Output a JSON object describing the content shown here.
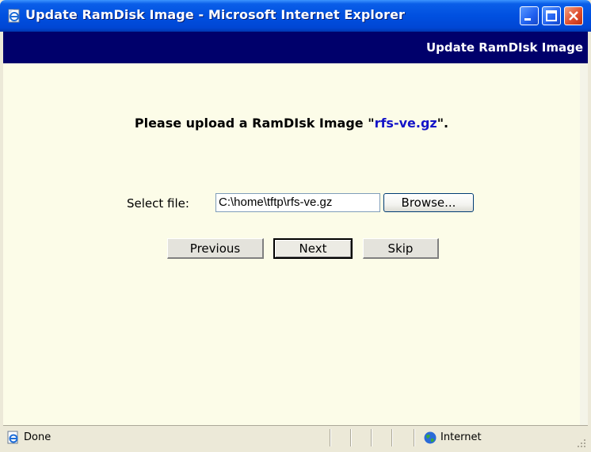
{
  "window": {
    "title": "Update RamDisk Image - Microsoft Internet Explorer",
    "controls": [
      "minimize-icon",
      "maximize-icon",
      "close-icon"
    ]
  },
  "page": {
    "header_title": "Update RamDIsk Image",
    "prompt_prefix": "Please upload a RamDIsk Image \"",
    "prompt_filename": "rfs-ve.gz",
    "prompt_suffix": "\"."
  },
  "form": {
    "file_label": "Select file:",
    "file_value": "C:\\home\\tftp\\rfs-ve.gz",
    "browse_label": "Browse..."
  },
  "nav": {
    "previous_label": "Previous",
    "next_label": "Next",
    "skip_label": "Skip"
  },
  "status": {
    "text": "Done",
    "zone": "Internet"
  },
  "colors": {
    "header_bg": "#00006b",
    "content_bg": "#fcfce8",
    "filename_link": "#1414c8",
    "titlebar": "#0050e0"
  }
}
